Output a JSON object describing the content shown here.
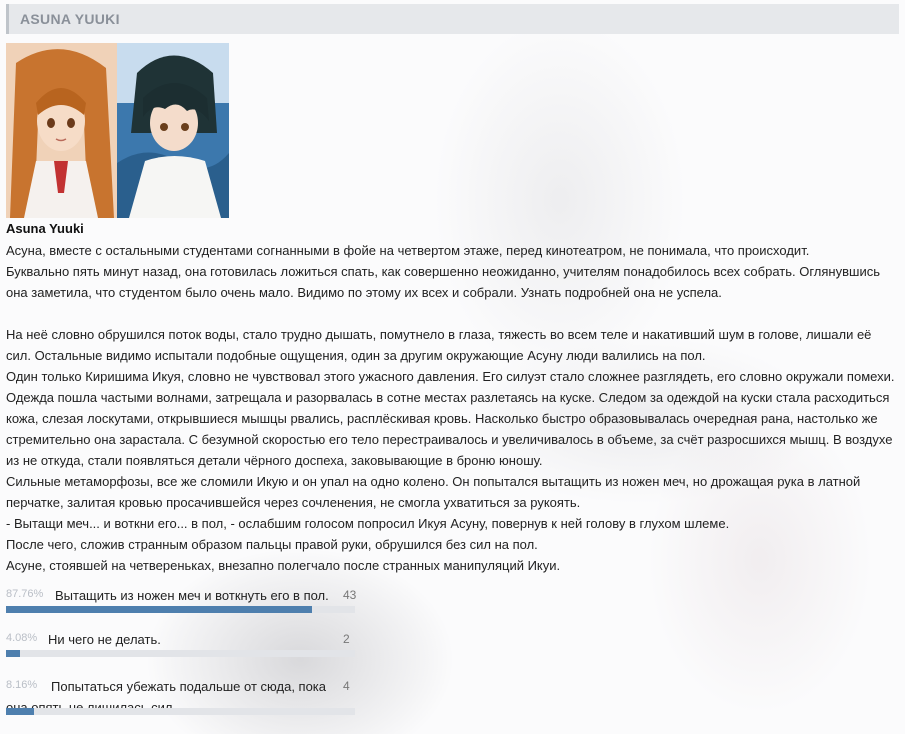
{
  "header": {
    "title": "ASUNA YUUKI"
  },
  "avatars": [
    {
      "icon": "asuna-portrait-image"
    },
    {
      "icon": "dark-haired-boy-portrait-image"
    }
  ],
  "post": {
    "character_name": "Asuna Yuuki",
    "lines": [
      "Асуна, вместе с остальными студентами согнанными в фойе на четвертом этаже, перед кинотеатром, не понимала, что происходит.",
      "Буквально пять минут назад, она готовилась ложиться спать, как совершенно неожиданно, учителям понадобилось всех собрать. Оглянувшись",
      "она заметила, что студентом было очень мало. Видимо по этому их всех и собрали. Узнать подробней она не успела.",
      "",
      "На неё словно обрушился поток воды, стало трудно дышать, помутнело в глаза, тяжесть во всем теле и накативший шум в голове, лишали её",
      "сил. Остальные видимо испытали подобные ощущения, один за другим окружающие Асуну люди валились на пол.",
      "Один только Киришима Икуя, словно не чувствовал этого ужасного давления. Его силуэт стало сложнее разглядеть, его словно окружали помехи.",
      "Одежда пошла частыми волнами, затрещала и разорвалась в сотне местах разлетаясь на куске. Следом за одеждой на куски стала расходиться",
      "кожа, слезая лоскутами, открывшиеся мышцы рвались, расплёскивая кровь. Насколько быстро образовывалась очередная рана, настолько же",
      "стремительно она зарастала. С безумной скоростью его тело перестраивалось и увеличивалось в объеме, за счёт разросшихся мышц. В воздухе",
      "из не откуда, стали появляться детали чёрного доспеха, заковывающие в броню юношу.",
      "Сильные метаморфозы, все же сломили Икую и он упал на одно колено. Он попытался вытащить из ножен меч, но дрожащая рука в латной",
      "перчатке, залитая кровью просачившейся через сочленения, не смогла ухватиться за рукоять.",
      "- Вытащи меч... и воткни его... в пол, - ослабшим голосом попросил Икуя Асуну, повернув к ней голову в глухом шлеме.",
      "После чего, сложив странным образом пальцы правой руки, обрушился без сил на пол.",
      "Асуне, стоявшей на четвереньках, внезапно полегчало после странных манипуляций Икуи."
    ]
  },
  "poll": {
    "accent_color": "#4e7fae",
    "options": [
      {
        "percent_text": "87.76%",
        "percent": 87.76,
        "label_lines": [
          "Вытащить из ножен меч и воткнуть его в пол."
        ],
        "count": "43"
      },
      {
        "percent_text": "4.08%",
        "percent": 4.08,
        "label_lines": [
          "Ни чего не делать."
        ],
        "count": "2"
      },
      {
        "percent_text": "8.16%",
        "percent": 8.16,
        "label_lines": [
          "Попытаться убежать подальше от сюда, пока",
          "она опять не лишилась сил."
        ],
        "count": "4"
      }
    ]
  }
}
